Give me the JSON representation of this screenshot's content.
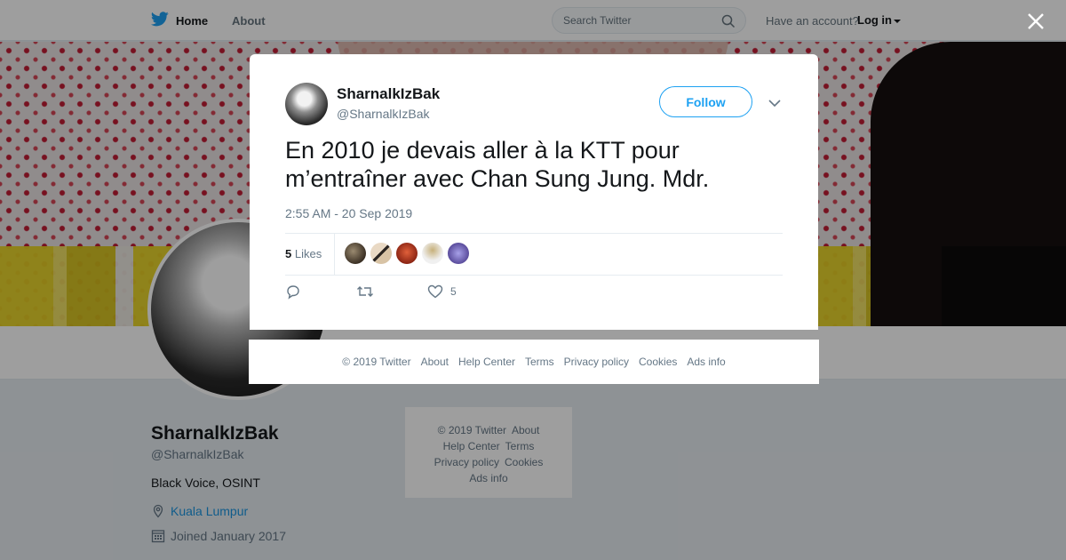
{
  "nav": {
    "home_label": "Home",
    "about_label": "About",
    "search_placeholder": "Search Twitter",
    "have_account": "Have an account?",
    "login_label": "Log in"
  },
  "profile": {
    "name": "SharnalkIzBak",
    "handle": "@SharnalkIzBak",
    "bio": "Black Voice, OSINT",
    "location": "Kuala Lumpur",
    "joined": "Joined January 2017"
  },
  "side_footer": {
    "links": [
      "© 2019 Twitter",
      "About",
      "Help Center",
      "Terms",
      "Privacy policy",
      "Cookies",
      "Ads info"
    ]
  },
  "tweet": {
    "author_name": "SharnalkIzBak",
    "author_handle": "@SharnalkIzBak",
    "follow_label": "Follow",
    "text": "En 2010 je devais aller à la KTT pour m’entraîner avec Chan Sung Jung. Mdr.",
    "timestamp": "2:55 AM - 20 Sep 2019",
    "likes_count": "5",
    "likes_label": "Likes",
    "like_action_count": "5"
  },
  "modal_footer": {
    "links": [
      "© 2019 Twitter",
      "About",
      "Help Center",
      "Terms",
      "Privacy policy",
      "Cookies",
      "Ads info"
    ]
  },
  "colors": {
    "accent": "#1da1f2",
    "link": "#1b95e0",
    "muted": "#657786",
    "text": "#14171a"
  },
  "icons": [
    "twitter-bird-icon",
    "search-icon",
    "caret-down-icon",
    "close-icon",
    "chevron-down-icon",
    "reply-icon",
    "retweet-icon",
    "heart-icon",
    "location-icon",
    "calendar-icon"
  ]
}
